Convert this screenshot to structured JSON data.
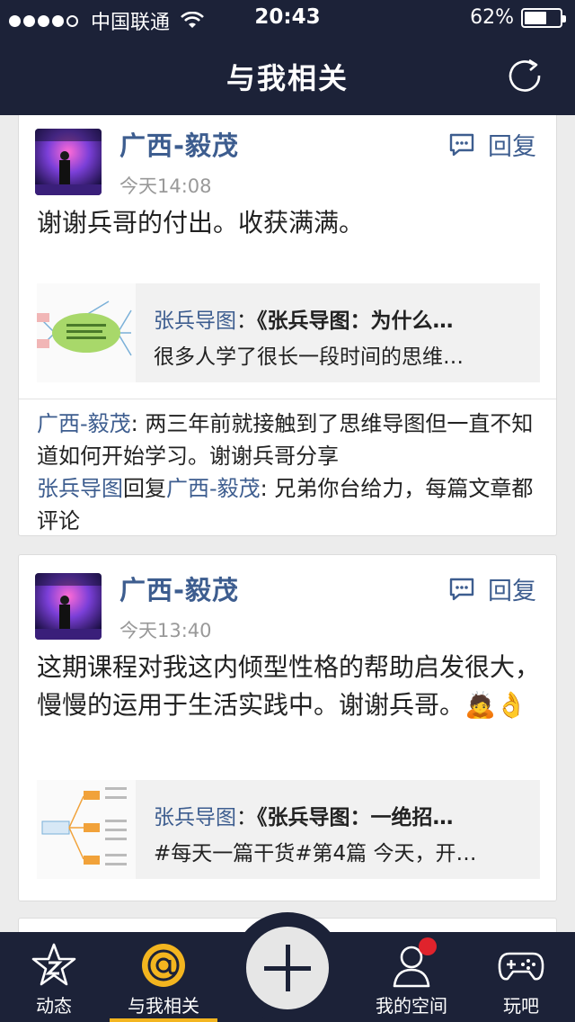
{
  "status_bar": {
    "carrier": "中国联通",
    "time": "20:43",
    "battery_text": "62%",
    "battery_level": 0.62
  },
  "header": {
    "title": "与我相关",
    "refresh_icon": "refresh-icon"
  },
  "feed": [
    {
      "author": "广西-毅茂",
      "time": "今天14:08",
      "reply_label": "回复",
      "text": "谢谢兵哥的付出。收获满满。",
      "share": {
        "source": "张兵导图",
        "colon": "：",
        "title": "《张兵导图：为什么…",
        "summary": "很多人学了很长一段时间的思维…"
      },
      "comments": [
        {
          "who": "广西-毅茂",
          "sep": ": ",
          "text": "两三年前就接触到了思维导图但一直不知道如何开始学习。谢谢兵哥分享"
        },
        {
          "who": "张兵导图",
          "verb": "回复",
          "to": "广西-毅茂",
          "sep": ": ",
          "text": "兄弟你台给力，每篇文章都评论"
        }
      ]
    },
    {
      "author": "广西-毅茂",
      "time": "今天13:40",
      "reply_label": "回复",
      "text": "这期课程对我这内倾型性格的帮助启发很大，慢慢的运用于生活实践中。谢谢兵哥。",
      "emojis": [
        "🙇",
        "👌"
      ],
      "share": {
        "source": "张兵导图",
        "colon": "：",
        "title": "《张兵导图：一绝招…",
        "summary": "#每天一篇干货#第4篇 今天，开…"
      }
    }
  ],
  "tabbar": {
    "items": [
      {
        "label": "动态",
        "icon": "star-icon"
      },
      {
        "label": "与我相关",
        "icon": "at-icon"
      },
      {
        "label": "",
        "icon": "plus-icon"
      },
      {
        "label": "我的空间",
        "icon": "user-icon"
      },
      {
        "label": "玩吧",
        "icon": "gamepad-icon"
      }
    ],
    "active_index": 1
  },
  "colors": {
    "header_bg": "#1c2238",
    "link_blue": "#3d5d8f",
    "accent_yellow": "#f3b51f",
    "badge_red": "#e0232c"
  }
}
